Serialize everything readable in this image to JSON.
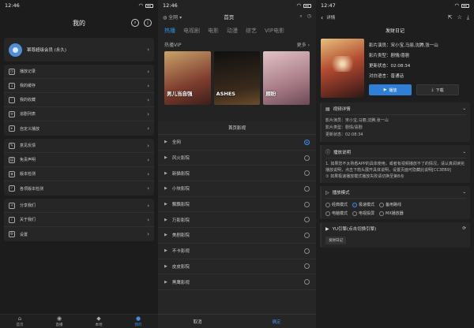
{
  "screen1": {
    "status_time": "12:46",
    "title": "我的",
    "user_name": "幂尊超级会员 (永久)",
    "group1": [
      "播放记录",
      "我的缓存",
      "我的收藏",
      "追剧列表",
      "自定义播放"
    ],
    "group2": [
      "意见反馈",
      "免责声明",
      "版本检测",
      "各项版本检测"
    ],
    "group3": [
      "分享我们",
      "关于我们",
      "设置"
    ],
    "nav": [
      "首页",
      "直播",
      "本地",
      "我的"
    ]
  },
  "screen2": {
    "status_time": "12:46",
    "location": "全网",
    "title": "首页",
    "tabs": [
      "热播",
      "电视剧",
      "电影",
      "动漫",
      "综艺",
      "VIP电影"
    ],
    "vip_label": "热播VIP",
    "more_label": "更多",
    "poster_titles": [
      "男儿当自强",
      "ASHES",
      "顾盼"
    ],
    "sheet_title": "首页影视",
    "sources": [
      "全网",
      "风火影院",
      "新猫影院",
      "小块影院",
      "飘飘影院",
      "万影影院",
      "美剧影院",
      "不卡影视",
      "皮皮影院",
      "黑鹰影视"
    ],
    "selected_index": 0,
    "cancel": "取消",
    "confirm": "确定"
  },
  "screen3": {
    "status_time": "12:47",
    "back_label": "详情",
    "movie_title": "发财日记",
    "actors": "影片演员：宋小宝,马丽,沈腾,张一山",
    "genre": "影片类型：剧情/喜剧",
    "status": "更新状态：02:08:34",
    "cast_extra": "对白语言：普通话",
    "play": "播放",
    "download": "下载",
    "detail_title": "视频详情",
    "detail_lines": [
      "影片演员：宋小宝,马丽,沈腾,张一山",
      "影片类型：剧情/喜剧",
      "更新状态：02:08:34"
    ],
    "notice_title": "播放说明",
    "notice_text": "1. 如果您不太熟悉APP的具体使用，或者有视频播放不了的情况，请认真阅读完播放说明，点击下箭头展开具体说明，设置页面可隐藏此说明[CC3EB9]",
    "notice_extra": "① 如果极速播放模式播放失败请切换至第8点",
    "mode_title": "播放模式",
    "modes": [
      "经典模式",
      "极速模式",
      "备用路线",
      "电脑模式",
      "电视投屏",
      "MX播放器"
    ],
    "mode_selected": 1,
    "engine_title": "YU引擎(点击切换引擎)",
    "chip": "发财日记"
  }
}
